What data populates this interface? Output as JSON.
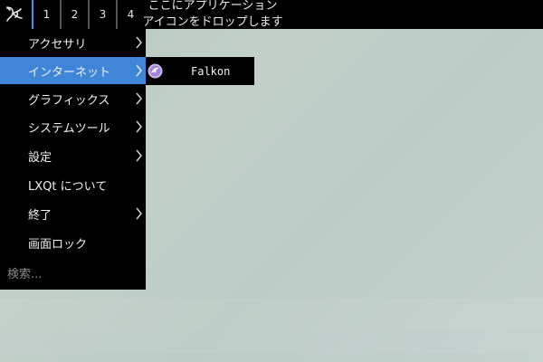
{
  "panel": {
    "desktops": [
      "1",
      "2",
      "3",
      "4"
    ],
    "active_desktop": "1",
    "quicklaunch_hint_line1": "ここにアプリケーション",
    "quicklaunch_hint_line2": "アイコンをドロップします"
  },
  "menu": {
    "items": [
      {
        "label": "アクセサリ",
        "has_submenu": true
      },
      {
        "label": "インターネット",
        "has_submenu": true,
        "selected": true
      },
      {
        "label": "グラフィックス",
        "has_submenu": true
      },
      {
        "label": "システムツール",
        "has_submenu": true
      },
      {
        "label": "設定",
        "has_submenu": true
      },
      {
        "label": "LXQt について",
        "has_submenu": false
      },
      {
        "label": "終了",
        "has_submenu": true
      },
      {
        "label": "画面ロック",
        "has_submenu": false
      }
    ],
    "search_placeholder": "検索..."
  },
  "submenu": {
    "items": [
      {
        "label": "Falkon",
        "icon": "falkon-icon"
      }
    ]
  },
  "colors": {
    "panel_bg": "#000000",
    "selection": "#3f86d8",
    "active_desktop_marker": "#4a8fe8",
    "desktop_bg": "#bcc9c4"
  }
}
